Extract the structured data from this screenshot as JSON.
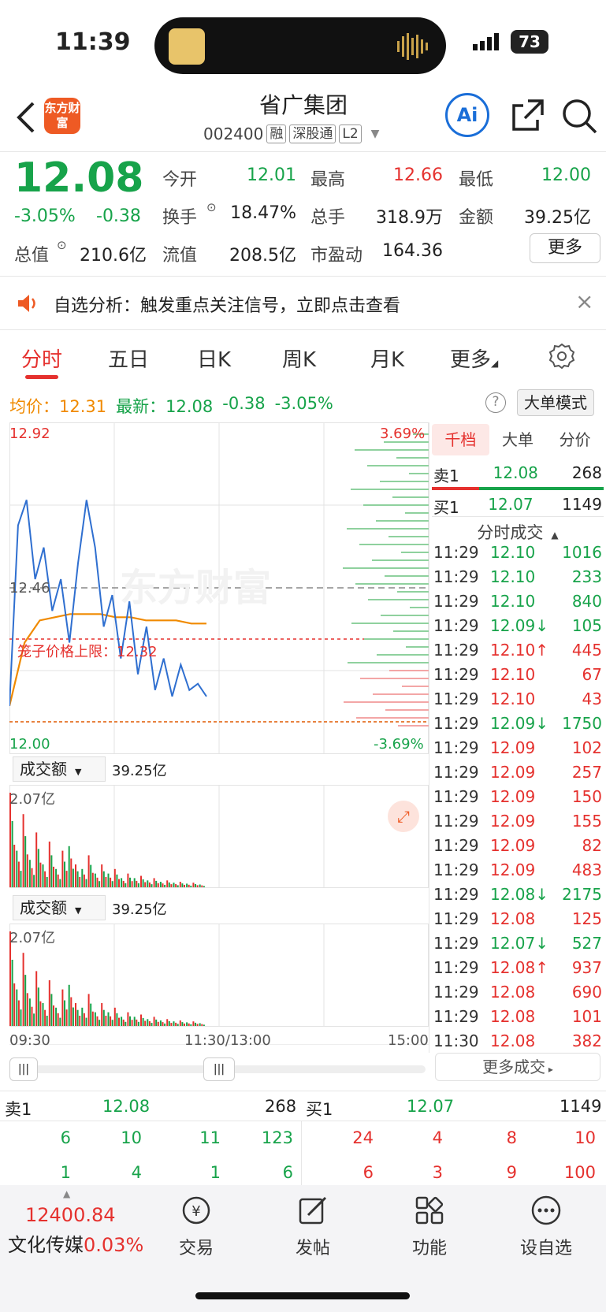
{
  "status": {
    "time": "11:39",
    "battery": "73"
  },
  "header": {
    "logo": "东方财富",
    "title": "省广集团",
    "code": "002400",
    "tags": [
      "融",
      "深股通",
      "L2"
    ]
  },
  "quote": {
    "price": "12.08",
    "change_pct": "-3.05%",
    "change": "-0.38",
    "fields": [
      {
        "label": "今开",
        "value": "12.01",
        "color": "green"
      },
      {
        "label": "最高",
        "value": "12.66",
        "color": "red"
      },
      {
        "label": "最低",
        "value": "12.00",
        "color": "green"
      },
      {
        "label": "换手",
        "value": "18.47%",
        "color": "dark"
      },
      {
        "label": "总手",
        "value": "318.9万",
        "color": "dark"
      },
      {
        "label": "金额",
        "value": "39.25亿",
        "color": "dark"
      },
      {
        "label": "总值",
        "value": "210.6亿",
        "color": "dark"
      },
      {
        "label": "流值",
        "value": "208.5亿",
        "color": "dark"
      },
      {
        "label": "市盈动",
        "value": "164.36",
        "color": "dark"
      }
    ],
    "more_label": "更多"
  },
  "banner": {
    "text": "自选分析：触发重点关注信号，立即点击查看"
  },
  "tabs": [
    "分时",
    "五日",
    "日K",
    "周K",
    "月K",
    "更多"
  ],
  "info": {
    "avg_label": "均价：",
    "avg": "12.31",
    "latest_label": "最新：",
    "latest": "12.08",
    "change": "-0.38",
    "change_pct": "-3.05%",
    "mode_label": "大单模式"
  },
  "chart_labels": {
    "y_top": "12.92",
    "y_mid": "12.46",
    "y_bottom": "12.00",
    "pct_top": "3.69%",
    "pct_bottom": "-3.69%",
    "limit_label": "笼子价格上限：12.32",
    "watermark": "东方财富",
    "vol_label": "成交额",
    "vol_total": "39.25亿",
    "vol_max": "2.07亿",
    "x_start": "09:30",
    "x_mid": "11:30/13:00",
    "x_end": "15:00"
  },
  "chart_data": {
    "type": "line",
    "y_range": [
      12.0,
      12.92
    ],
    "series": [
      {
        "name": "price",
        "values": [
          12.05,
          12.62,
          12.7,
          12.45,
          12.55,
          12.35,
          12.45,
          12.25,
          12.5,
          12.7,
          12.55,
          12.3,
          12.4,
          12.2,
          12.38,
          12.15,
          12.3,
          12.1,
          12.2,
          12.08,
          12.18,
          12.1,
          12.12,
          12.08
        ]
      },
      {
        "name": "avg",
        "values": [
          12.05,
          12.25,
          12.32,
          12.33,
          12.34,
          12.34,
          12.34,
          12.33,
          12.33,
          12.32,
          12.32,
          12.32,
          12.31,
          12.31
        ]
      }
    ],
    "volume": [
      2.07,
      0.8,
      1.6,
      0.6,
      1.2,
      0.5,
      1.0,
      0.4,
      0.8,
      0.9,
      0.5,
      0.4,
      0.7,
      0.3,
      0.5,
      0.3,
      0.4,
      0.2,
      0.3,
      0.2,
      0.25,
      0.15,
      0.2,
      0.12,
      0.15,
      0.1,
      0.12,
      0.08,
      0.1,
      0.06
    ]
  },
  "order_book": {
    "tabs": [
      "千档",
      "大单",
      "分价"
    ],
    "sell1": {
      "label": "卖1",
      "price": "12.08",
      "qty": "268"
    },
    "buy1": {
      "label": "买1",
      "price": "12.07",
      "qty": "1149"
    },
    "ticks_title": "分时成交",
    "ticks": [
      {
        "time": "11:29",
        "price": "12.10",
        "vol": "1016",
        "c": "green"
      },
      {
        "time": "11:29",
        "price": "12.10",
        "vol": "233",
        "c": "green"
      },
      {
        "time": "11:29",
        "price": "12.10",
        "vol": "840",
        "c": "green"
      },
      {
        "time": "11:29",
        "price": "12.09↓",
        "vol": "105",
        "c": "green"
      },
      {
        "time": "11:29",
        "price": "12.10↑",
        "vol": "445",
        "c": "red"
      },
      {
        "time": "11:29",
        "price": "12.10",
        "vol": "67",
        "c": "red"
      },
      {
        "time": "11:29",
        "price": "12.10",
        "vol": "43",
        "c": "red"
      },
      {
        "time": "11:29",
        "price": "12.09↓",
        "vol": "1750",
        "c": "green"
      },
      {
        "time": "11:29",
        "price": "12.09",
        "vol": "102",
        "c": "red"
      },
      {
        "time": "11:29",
        "price": "12.09",
        "vol": "257",
        "c": "red"
      },
      {
        "time": "11:29",
        "price": "12.09",
        "vol": "150",
        "c": "red"
      },
      {
        "time": "11:29",
        "price": "12.09",
        "vol": "155",
        "c": "red"
      },
      {
        "time": "11:29",
        "price": "12.09",
        "vol": "82",
        "c": "red"
      },
      {
        "time": "11:29",
        "price": "12.09",
        "vol": "483",
        "c": "red"
      },
      {
        "time": "11:29",
        "price": "12.08↓",
        "vol": "2175",
        "c": "green"
      },
      {
        "time": "11:29",
        "price": "12.08",
        "vol": "125",
        "c": "red"
      },
      {
        "time": "11:29",
        "price": "12.07↓",
        "vol": "527",
        "c": "green"
      },
      {
        "time": "11:29",
        "price": "12.08↑",
        "vol": "937",
        "c": "red"
      },
      {
        "time": "11:29",
        "price": "12.08",
        "vol": "690",
        "c": "red"
      },
      {
        "time": "11:29",
        "price": "12.08",
        "vol": "101",
        "c": "red"
      },
      {
        "time": "11:30",
        "price": "12.08",
        "vol": "382",
        "c": "red"
      }
    ],
    "more_trades": "更多成交"
  },
  "depth": {
    "sell_label": "卖1",
    "sell_price": "12.08",
    "sell_qty": "268",
    "buy_label": "买1",
    "buy_price": "12.07",
    "buy_qty": "1149",
    "sell_row1": [
      "6",
      "10",
      "11",
      "123"
    ],
    "sell_row2": [
      "1",
      "4",
      "1",
      "6"
    ],
    "buy_row1": [
      "24",
      "4",
      "8",
      "10"
    ],
    "buy_row2": [
      "6",
      "3",
      "9",
      "100"
    ]
  },
  "bottom_bar": {
    "index_value": "12400.84",
    "index_name": "文化传媒",
    "index_pct": "0.03%",
    "items": [
      "交易",
      "发帖",
      "功能",
      "设自选"
    ]
  },
  "colors": {
    "red": "#e5312e",
    "green": "#17a34a",
    "orange": "#f08a00",
    "blue": "#1a6ed8"
  }
}
